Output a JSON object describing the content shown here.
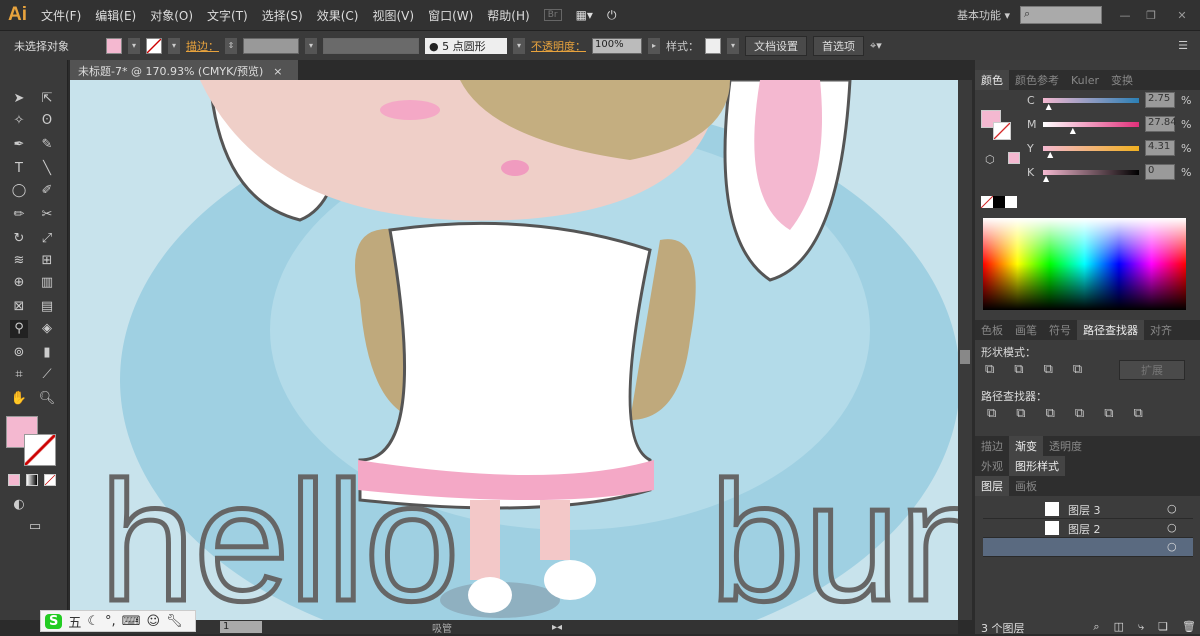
{
  "app": {
    "logo": "Ai",
    "menus": [
      "文件(F)",
      "编辑(E)",
      "对象(O)",
      "文字(T)",
      "选择(S)",
      "效果(C)",
      "视图(V)",
      "窗口(W)",
      "帮助(H)"
    ],
    "bridge": "Br",
    "workspace": "基本功能",
    "search_placeholder": ""
  },
  "control": {
    "selection": "未选择对象",
    "stroke_label": "描边：",
    "brush": "5 点圆形",
    "opacity_label": "不透明度：",
    "opacity": "100%",
    "style_label": "样式：",
    "doc_setup": "文档设置",
    "preferences": "首选项",
    "fill_color": "#f4b8d0"
  },
  "document": {
    "tab": "未标题-7* @ 170.93% (CMYK/预览)",
    "close": "×"
  },
  "artwork": {
    "text_left": "hello",
    "text_right": "bunn"
  },
  "color_panel": {
    "tabs": [
      "颜色",
      "颜色参考",
      "Kuler",
      "变换"
    ],
    "channels": [
      {
        "label": "C",
        "value": "2.75",
        "pct": 2.75,
        "gradient": "linear-gradient(90deg,#f4b8d0,#2b7fb5)"
      },
      {
        "label": "M",
        "value": "27.84",
        "pct": 27.84,
        "gradient": "linear-gradient(90deg,#fff,#e0307a)"
      },
      {
        "label": "Y",
        "value": "4.31",
        "pct": 4.31,
        "gradient": "linear-gradient(90deg,#f4b8d0,#f0b020)"
      },
      {
        "label": "K",
        "value": "0",
        "pct": 0,
        "gradient": "linear-gradient(90deg,#f4b8d0,#000)"
      }
    ],
    "unit": "%"
  },
  "pathfinder": {
    "tabs": [
      "色板",
      "画笔",
      "符号",
      "路径查找器",
      "对齐"
    ],
    "shape_modes": "形状模式：",
    "expand": "扩展",
    "pathfinders": "路径查找器："
  },
  "gradient_tabs": [
    "描边",
    "渐变",
    "透明度"
  ],
  "appearance_tabs": [
    "外观",
    "图形样式"
  ],
  "layers": {
    "tabs": [
      "图层",
      "画板"
    ],
    "items": [
      "图层 3",
      "图层 2",
      ""
    ],
    "count": "3 个图层"
  },
  "status": {
    "page": "1",
    "tool": "吸管"
  },
  "ime": {
    "mode": "五"
  }
}
